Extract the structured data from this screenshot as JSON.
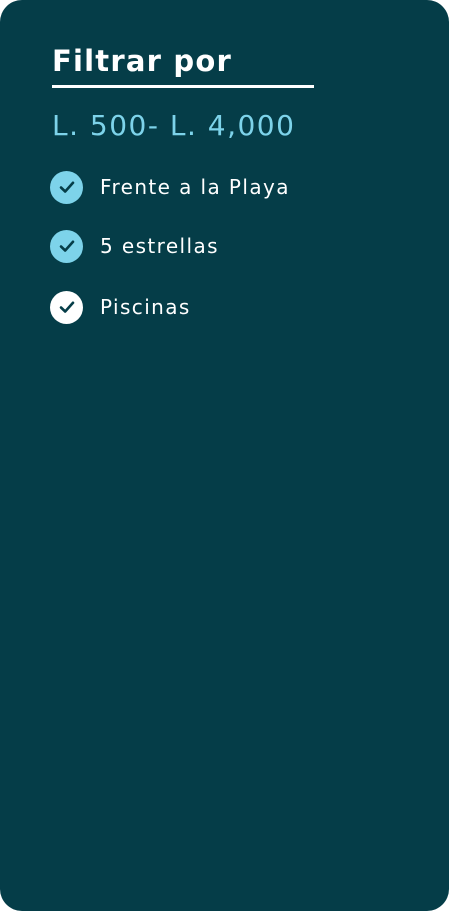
{
  "filter_panel": {
    "title": "Filtrar por",
    "price_range": "L. 500- L. 4,000",
    "options": [
      {
        "label": "Frente a la Playa",
        "checked": true,
        "check_color": "#7dd3ea",
        "icon": "check-circle-icon"
      },
      {
        "label": "5 estrellas",
        "checked": true,
        "check_color": "#7dd3ea",
        "icon": "check-circle-icon"
      },
      {
        "label": "Piscinas",
        "checked": true,
        "check_color": "#ffffff",
        "icon": "check-circle-icon"
      }
    ]
  },
  "colors": {
    "panel_background": "#053d48",
    "accent": "#7dd3ea",
    "text": "#ffffff",
    "check_mark": "#053d48"
  }
}
